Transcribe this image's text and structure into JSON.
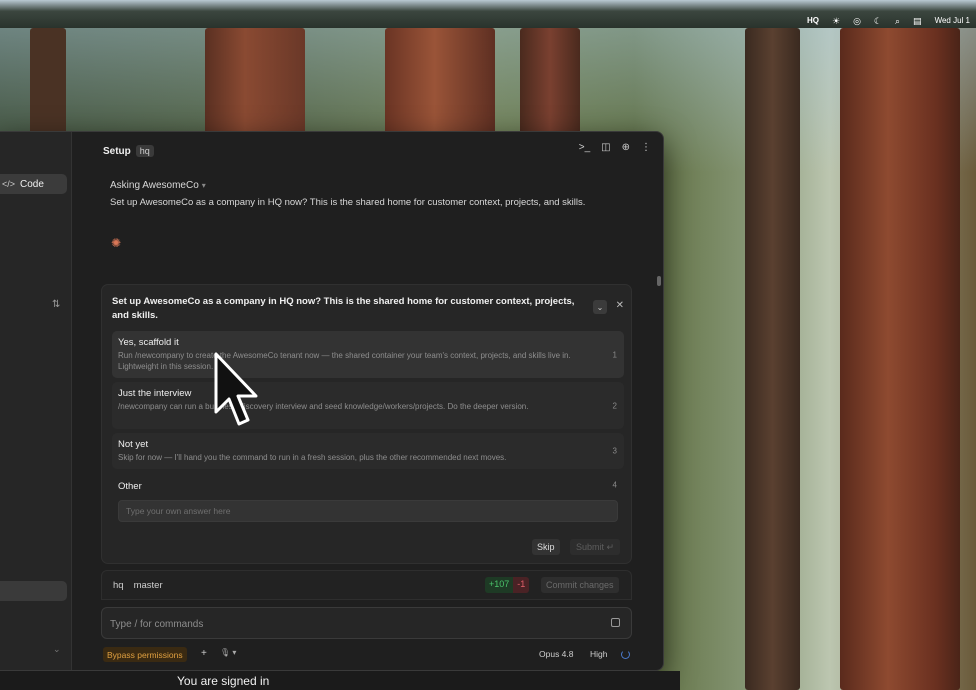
{
  "menubar": {
    "items": [
      "HQ",
      "☀",
      "◎",
      "☾",
      "⌕",
      "▤",
      "Wed Jul 1"
    ]
  },
  "sidebar": {
    "code_label": "Code"
  },
  "header": {
    "title": "Setup",
    "tag": "hq",
    "icons": [
      "terminal-icon",
      "panel-icon",
      "globe-icon",
      "more-icon"
    ]
  },
  "conversation": {
    "asking_label": "Asking AwesomeCo",
    "question": "Set up AwesomeCo as a company in HQ now? This is the shared home for customer context, projects, and skills."
  },
  "question_card": {
    "title": "Set up AwesomeCo as a company in HQ now? This is the shared home for customer context, projects, and skills.",
    "options": [
      {
        "label": "Yes, scaffold it",
        "description": "Run /newcompany to create the AwesomeCo tenant now — the shared container your team's context, projects, and skills live in. Lightweight in this session.",
        "number": "1"
      },
      {
        "label": "Just the interview",
        "description": "/newcompany can run a business-discovery interview and seed knowledge/workers/projects. Do the deeper version.",
        "number": "2"
      },
      {
        "label": "Not yet",
        "description": "Skip for now — I'll hand you the command to run in a fresh session, plus the other recommended next moves.",
        "number": "3"
      },
      {
        "label": "Other",
        "description": "",
        "number": "4"
      }
    ],
    "other_placeholder": "Type your own answer here",
    "skip_label": "Skip",
    "submit_label": "Submit ↵"
  },
  "branch_bar": {
    "repo": "hq",
    "branch": "master",
    "additions": "+107",
    "deletions": "-1",
    "commit_label": "Commit changes"
  },
  "prompt": {
    "placeholder": "Type / for commands"
  },
  "footer": {
    "permission_mode": "Bypass permissions",
    "plus": "+",
    "mic": "🎙 ▾",
    "model": "Opus 4.8",
    "effort": "High"
  },
  "overlay": {
    "signed_in_text": "You are signed in"
  },
  "colors": {
    "accent_spark": "#d97757",
    "bypass_text": "#e0a040",
    "additions": "#4bc46a",
    "deletions": "#e0606a"
  }
}
